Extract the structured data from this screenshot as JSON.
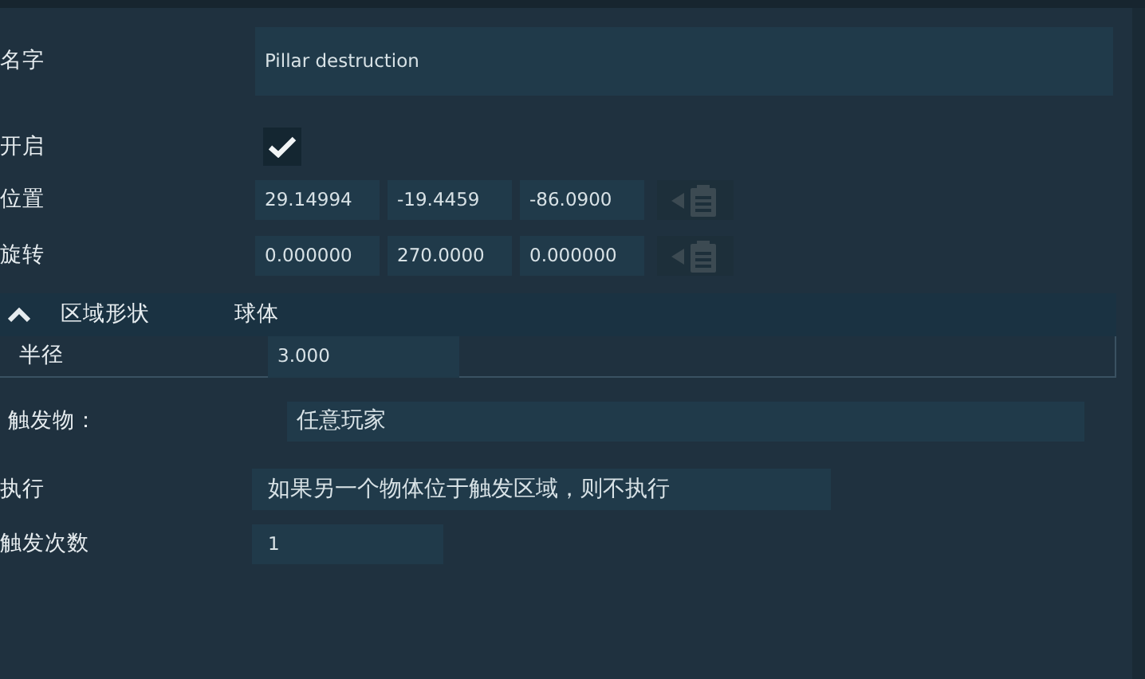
{
  "name": {
    "label": "名字",
    "value": "Pillar destruction"
  },
  "enabled": {
    "label": "开启",
    "checked": true
  },
  "position": {
    "label": "位置",
    "values": [
      "29.14994",
      "-19.4459",
      "-86.0900"
    ],
    "paste_disabled": true
  },
  "rotation": {
    "label": "旋转",
    "values": [
      "0.000000",
      "270.0000",
      "0.000000"
    ],
    "paste_disabled": true
  },
  "area_shape": {
    "label": "区域形状",
    "value": "球体",
    "expanded": true,
    "radius": {
      "label": "半径",
      "value": "3.000"
    }
  },
  "trigger": {
    "label": "触发物：",
    "value": "任意玩家"
  },
  "execute": {
    "label": "执行",
    "value": "如果另一个物体位于触发区域，则不执行"
  },
  "trigger_count": {
    "label": "触发次数",
    "value": "1"
  }
}
